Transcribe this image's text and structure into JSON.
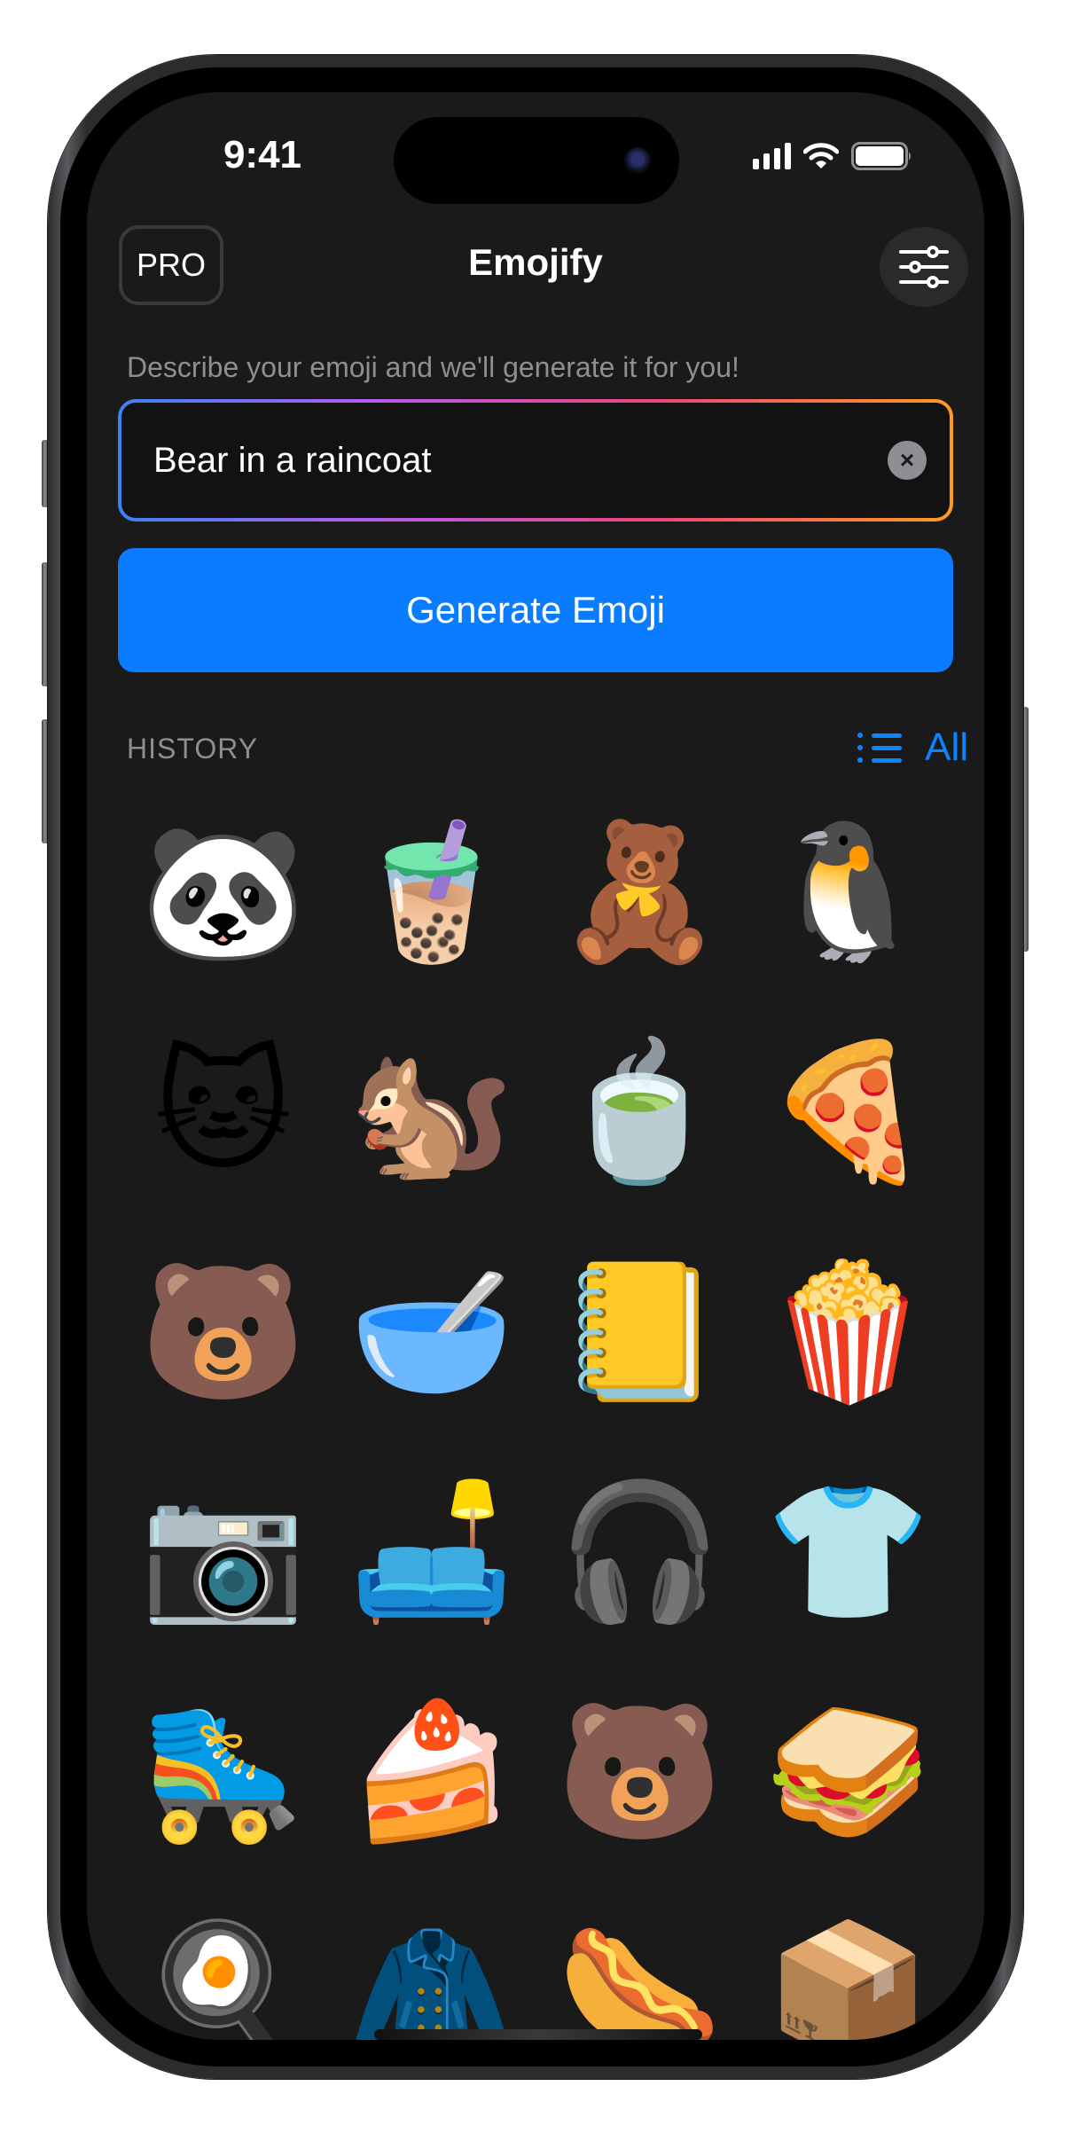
{
  "status_bar": {
    "time": "9:41",
    "signal_icon": "cellular-signal-icon",
    "wifi_icon": "wifi-icon",
    "battery_icon": "battery-icon"
  },
  "header": {
    "pro_label": "PRO",
    "title": "Emojify",
    "settings_icon": "sliders-icon"
  },
  "prompt": {
    "label": "Describe your emoji and we'll generate it for you!",
    "value": "Bear in a raincoat",
    "clear_icon": "clear-x-icon",
    "clear_glyph": "×"
  },
  "generate_button": {
    "label": "Generate Emoji"
  },
  "history": {
    "label": "HISTORY",
    "all_label": "All",
    "all_icon": "list-icon",
    "items": [
      {
        "name": "panda-on-swing",
        "glyph": "🐼"
      },
      {
        "name": "bubble-tea",
        "glyph": "🧋"
      },
      {
        "name": "bear-in-yellow-raincoat",
        "glyph": "🧸"
      },
      {
        "name": "penguin-in-blanket",
        "glyph": "🐧"
      },
      {
        "name": "cat-on-cloud",
        "glyph": "🐱"
      },
      {
        "name": "squirrel-with-sunglasses",
        "glyph": "🐿️"
      },
      {
        "name": "matcha-latte",
        "glyph": "🍵"
      },
      {
        "name": "heart-pizza",
        "glyph": "🍕"
      },
      {
        "name": "gummy-bear",
        "glyph": "🐻"
      },
      {
        "name": "acai-bowl",
        "glyph": "🥣"
      },
      {
        "name": "planner-notebook",
        "glyph": "📒"
      },
      {
        "name": "popcorn",
        "glyph": "🍿"
      },
      {
        "name": "polaroid-camera",
        "glyph": "📷"
      },
      {
        "name": "bean-bag",
        "glyph": "🛋️"
      },
      {
        "name": "airpods-case",
        "glyph": "🎧"
      },
      {
        "name": "tie-dye-shirt",
        "glyph": "👕"
      },
      {
        "name": "inline-skate",
        "glyph": "🛼"
      },
      {
        "name": "matcha-cheesecake",
        "glyph": "🍰"
      },
      {
        "name": "bear-in-raincoat-hood",
        "glyph": "🐻"
      },
      {
        "name": "grilled-cheese-stack",
        "glyph": "🥪"
      },
      {
        "name": "steak-and-eggs",
        "glyph": "🍳"
      },
      {
        "name": "puffer-jacket",
        "glyph": "🧥"
      },
      {
        "name": "hot-dog",
        "glyph": "🌭"
      },
      {
        "name": "cat-in-box",
        "glyph": "📦"
      }
    ]
  },
  "colors": {
    "accent": "#0a84ff",
    "button": "#0a7cff",
    "background": "#1a1a1a",
    "secondary_text": "#8e8e93"
  }
}
